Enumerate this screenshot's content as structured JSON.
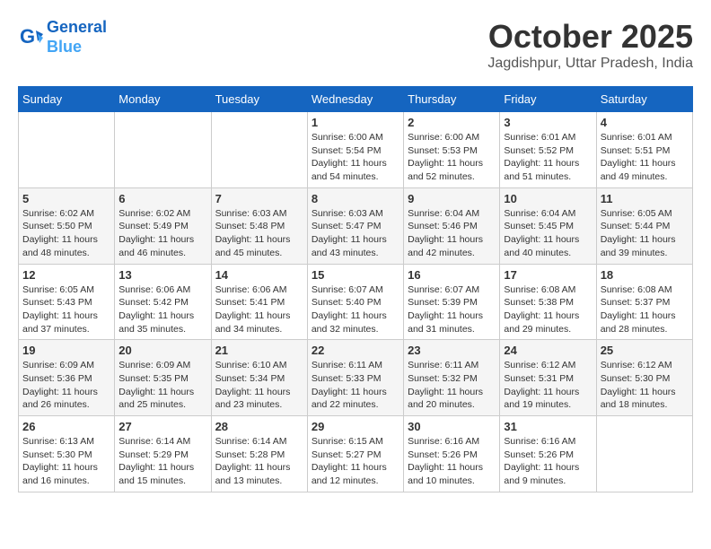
{
  "header": {
    "logo_line1": "General",
    "logo_line2": "Blue",
    "month": "October 2025",
    "location": "Jagdishpur, Uttar Pradesh, India"
  },
  "weekdays": [
    "Sunday",
    "Monday",
    "Tuesday",
    "Wednesday",
    "Thursday",
    "Friday",
    "Saturday"
  ],
  "weeks": [
    [
      {
        "day": "",
        "info": ""
      },
      {
        "day": "",
        "info": ""
      },
      {
        "day": "",
        "info": ""
      },
      {
        "day": "1",
        "info": "Sunrise: 6:00 AM\nSunset: 5:54 PM\nDaylight: 11 hours\nand 54 minutes."
      },
      {
        "day": "2",
        "info": "Sunrise: 6:00 AM\nSunset: 5:53 PM\nDaylight: 11 hours\nand 52 minutes."
      },
      {
        "day": "3",
        "info": "Sunrise: 6:01 AM\nSunset: 5:52 PM\nDaylight: 11 hours\nand 51 minutes."
      },
      {
        "day": "4",
        "info": "Sunrise: 6:01 AM\nSunset: 5:51 PM\nDaylight: 11 hours\nand 49 minutes."
      }
    ],
    [
      {
        "day": "5",
        "info": "Sunrise: 6:02 AM\nSunset: 5:50 PM\nDaylight: 11 hours\nand 48 minutes."
      },
      {
        "day": "6",
        "info": "Sunrise: 6:02 AM\nSunset: 5:49 PM\nDaylight: 11 hours\nand 46 minutes."
      },
      {
        "day": "7",
        "info": "Sunrise: 6:03 AM\nSunset: 5:48 PM\nDaylight: 11 hours\nand 45 minutes."
      },
      {
        "day": "8",
        "info": "Sunrise: 6:03 AM\nSunset: 5:47 PM\nDaylight: 11 hours\nand 43 minutes."
      },
      {
        "day": "9",
        "info": "Sunrise: 6:04 AM\nSunset: 5:46 PM\nDaylight: 11 hours\nand 42 minutes."
      },
      {
        "day": "10",
        "info": "Sunrise: 6:04 AM\nSunset: 5:45 PM\nDaylight: 11 hours\nand 40 minutes."
      },
      {
        "day": "11",
        "info": "Sunrise: 6:05 AM\nSunset: 5:44 PM\nDaylight: 11 hours\nand 39 minutes."
      }
    ],
    [
      {
        "day": "12",
        "info": "Sunrise: 6:05 AM\nSunset: 5:43 PM\nDaylight: 11 hours\nand 37 minutes."
      },
      {
        "day": "13",
        "info": "Sunrise: 6:06 AM\nSunset: 5:42 PM\nDaylight: 11 hours\nand 35 minutes."
      },
      {
        "day": "14",
        "info": "Sunrise: 6:06 AM\nSunset: 5:41 PM\nDaylight: 11 hours\nand 34 minutes."
      },
      {
        "day": "15",
        "info": "Sunrise: 6:07 AM\nSunset: 5:40 PM\nDaylight: 11 hours\nand 32 minutes."
      },
      {
        "day": "16",
        "info": "Sunrise: 6:07 AM\nSunset: 5:39 PM\nDaylight: 11 hours\nand 31 minutes."
      },
      {
        "day": "17",
        "info": "Sunrise: 6:08 AM\nSunset: 5:38 PM\nDaylight: 11 hours\nand 29 minutes."
      },
      {
        "day": "18",
        "info": "Sunrise: 6:08 AM\nSunset: 5:37 PM\nDaylight: 11 hours\nand 28 minutes."
      }
    ],
    [
      {
        "day": "19",
        "info": "Sunrise: 6:09 AM\nSunset: 5:36 PM\nDaylight: 11 hours\nand 26 minutes."
      },
      {
        "day": "20",
        "info": "Sunrise: 6:09 AM\nSunset: 5:35 PM\nDaylight: 11 hours\nand 25 minutes."
      },
      {
        "day": "21",
        "info": "Sunrise: 6:10 AM\nSunset: 5:34 PM\nDaylight: 11 hours\nand 23 minutes."
      },
      {
        "day": "22",
        "info": "Sunrise: 6:11 AM\nSunset: 5:33 PM\nDaylight: 11 hours\nand 22 minutes."
      },
      {
        "day": "23",
        "info": "Sunrise: 6:11 AM\nSunset: 5:32 PM\nDaylight: 11 hours\nand 20 minutes."
      },
      {
        "day": "24",
        "info": "Sunrise: 6:12 AM\nSunset: 5:31 PM\nDaylight: 11 hours\nand 19 minutes."
      },
      {
        "day": "25",
        "info": "Sunrise: 6:12 AM\nSunset: 5:30 PM\nDaylight: 11 hours\nand 18 minutes."
      }
    ],
    [
      {
        "day": "26",
        "info": "Sunrise: 6:13 AM\nSunset: 5:30 PM\nDaylight: 11 hours\nand 16 minutes."
      },
      {
        "day": "27",
        "info": "Sunrise: 6:14 AM\nSunset: 5:29 PM\nDaylight: 11 hours\nand 15 minutes."
      },
      {
        "day": "28",
        "info": "Sunrise: 6:14 AM\nSunset: 5:28 PM\nDaylight: 11 hours\nand 13 minutes."
      },
      {
        "day": "29",
        "info": "Sunrise: 6:15 AM\nSunset: 5:27 PM\nDaylight: 11 hours\nand 12 minutes."
      },
      {
        "day": "30",
        "info": "Sunrise: 6:16 AM\nSunset: 5:26 PM\nDaylight: 11 hours\nand 10 minutes."
      },
      {
        "day": "31",
        "info": "Sunrise: 6:16 AM\nSunset: 5:26 PM\nDaylight: 11 hours\nand 9 minutes."
      },
      {
        "day": "",
        "info": ""
      }
    ]
  ]
}
